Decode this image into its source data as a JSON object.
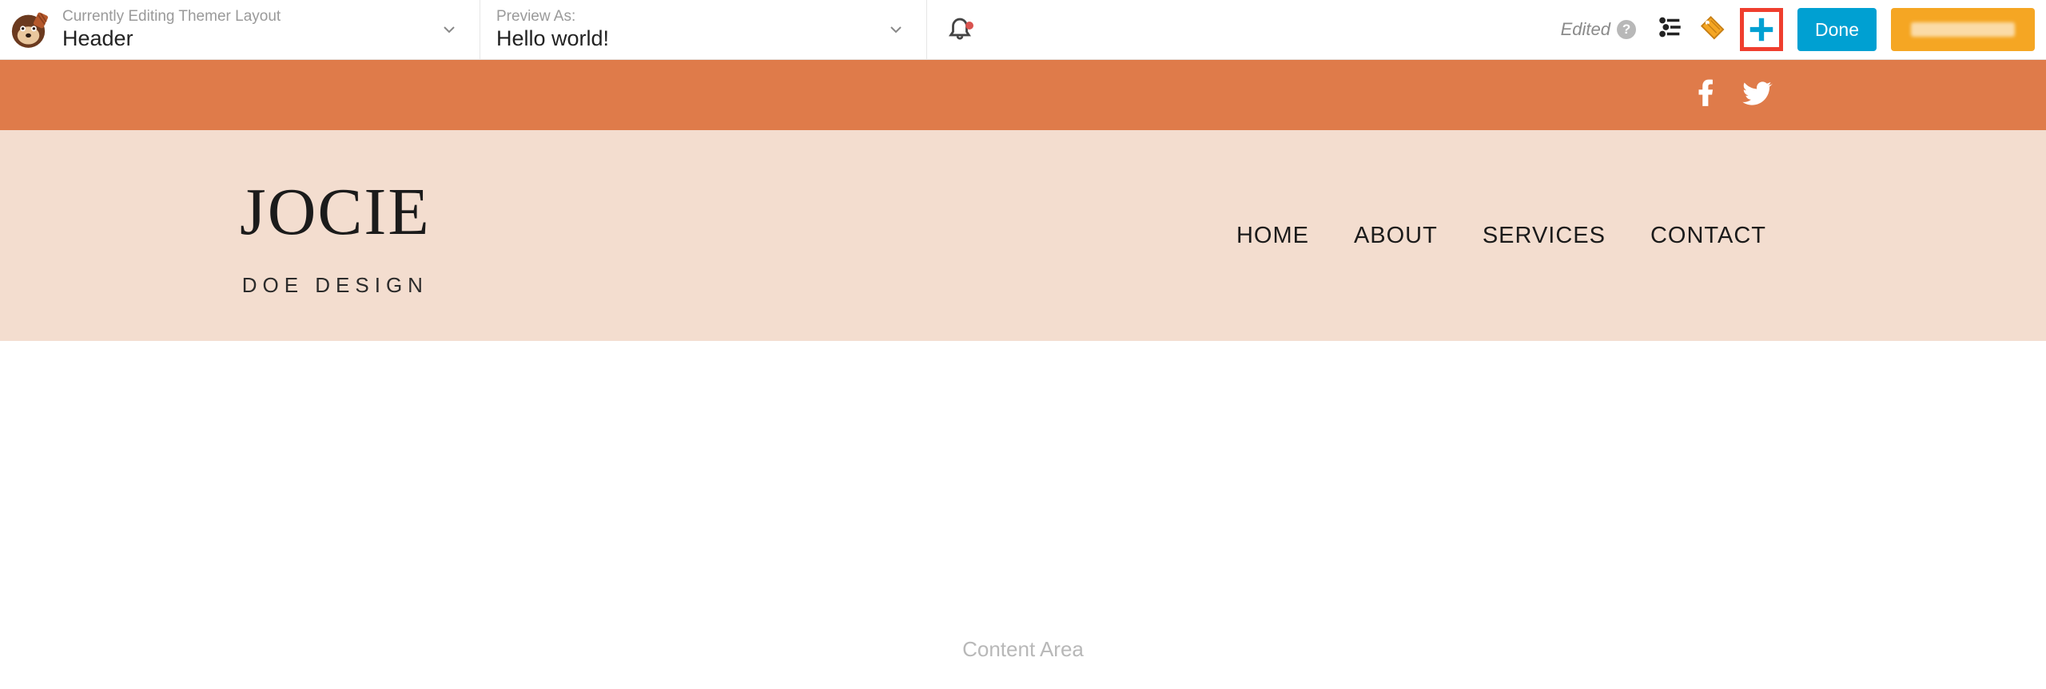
{
  "toolbar": {
    "editing_label": "Currently Editing Themer Layout",
    "editing_value": "Header",
    "preview_label": "Preview As:",
    "preview_value": "Hello world!",
    "edited_label": "Edited",
    "done_label": "Done"
  },
  "social": {
    "icons": [
      "facebook",
      "twitter"
    ]
  },
  "header": {
    "logo_main": "JOCIE",
    "logo_sub": "DOE DESIGN",
    "nav": [
      "HOME",
      "ABOUT",
      "SERVICES",
      "CONTACT"
    ]
  },
  "content": {
    "placeholder": "Content Area"
  },
  "colors": {
    "orange_bar": "#df7b4a",
    "header_bg": "#f3ddcf",
    "done_btn": "#00a0d2",
    "publish_btn": "#f5a623",
    "highlight_red": "#ef3e2e"
  }
}
